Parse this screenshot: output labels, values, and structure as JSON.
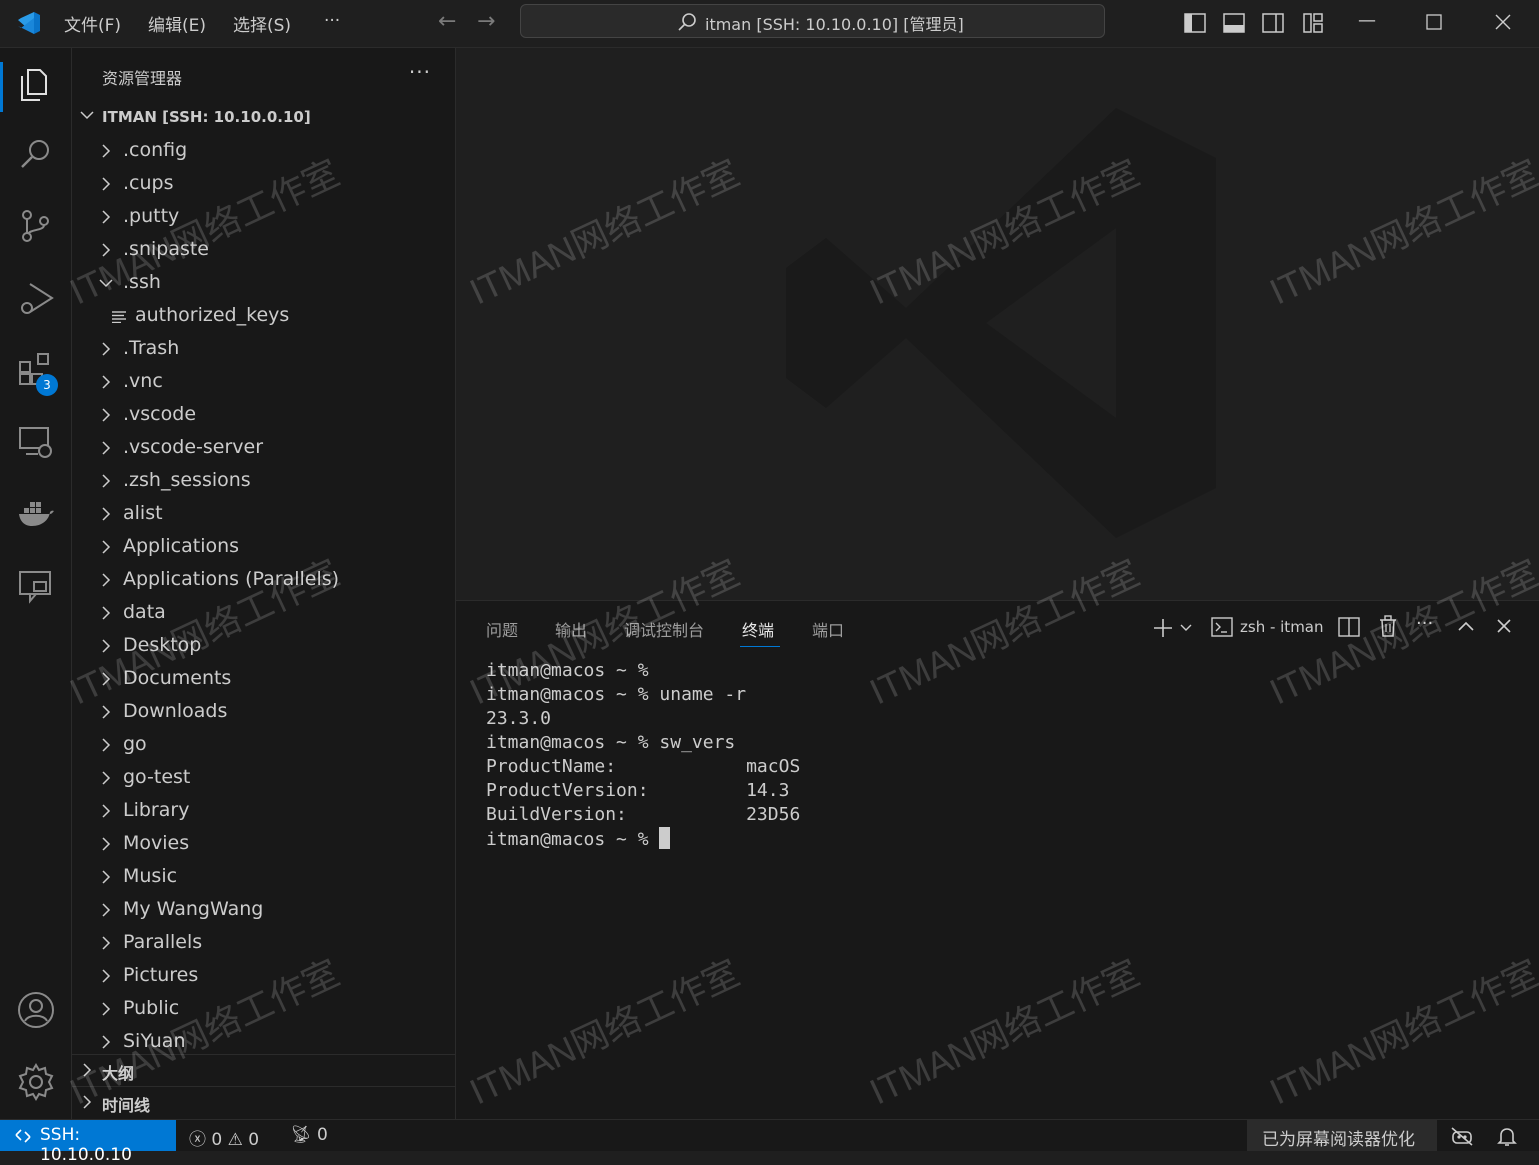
{
  "titlebar": {
    "menu": [
      "文件(F)",
      "编辑(E)",
      "选择(S)",
      "···"
    ],
    "command_center": "itman [SSH: 10.10.0.10] [管理员]"
  },
  "activity_bar": {
    "extensions_badge": "3"
  },
  "sidebar": {
    "title": "资源管理器",
    "more": "···",
    "root": "ITMAN [SSH: 10.10.0.10]",
    "items": [
      {
        "label": ".config",
        "type": "folder"
      },
      {
        "label": ".cups",
        "type": "folder"
      },
      {
        "label": ".putty",
        "type": "folder"
      },
      {
        "label": ".snipaste",
        "type": "folder"
      },
      {
        "label": ".ssh",
        "type": "folder-open"
      },
      {
        "label": "authorized_keys",
        "type": "file"
      },
      {
        "label": ".Trash",
        "type": "folder"
      },
      {
        "label": ".vnc",
        "type": "folder"
      },
      {
        "label": ".vscode",
        "type": "folder"
      },
      {
        "label": ".vscode-server",
        "type": "folder"
      },
      {
        "label": ".zsh_sessions",
        "type": "folder"
      },
      {
        "label": "alist",
        "type": "folder"
      },
      {
        "label": "Applications",
        "type": "folder"
      },
      {
        "label": "Applications (Parallels)",
        "type": "folder"
      },
      {
        "label": "data",
        "type": "folder"
      },
      {
        "label": "Desktop",
        "type": "folder"
      },
      {
        "label": "Documents",
        "type": "folder"
      },
      {
        "label": "Downloads",
        "type": "folder"
      },
      {
        "label": "go",
        "type": "folder"
      },
      {
        "label": "go-test",
        "type": "folder"
      },
      {
        "label": "Library",
        "type": "folder"
      },
      {
        "label": "Movies",
        "type": "folder"
      },
      {
        "label": "Music",
        "type": "folder"
      },
      {
        "label": "My WangWang",
        "type": "folder"
      },
      {
        "label": "Parallels",
        "type": "folder"
      },
      {
        "label": "Pictures",
        "type": "folder"
      },
      {
        "label": "Public",
        "type": "folder"
      },
      {
        "label": "SiYuan",
        "type": "folder"
      }
    ],
    "sections": [
      "大纲",
      "时间线"
    ]
  },
  "panel": {
    "tabs": [
      "问题",
      "输出",
      "调试控制台",
      "终端",
      "端口"
    ],
    "active_tab": "终端",
    "terminal_name": "zsh - itman",
    "terminal_lines": [
      "itman@macos ~ %",
      "itman@macos ~ % uname -r",
      "23.3.0",
      "itman@macos ~ % sw_vers",
      "ProductName:\t\tmacOS",
      "ProductVersion:\t\t14.3",
      "BuildVersion:\t\t23D56"
    ],
    "prompt": "itman@macos ~ % "
  },
  "statusbar": {
    "remote": "SSH: 10.10.0.10",
    "errors": "0",
    "warnings": "0",
    "ports": "0",
    "screen_reader": "已为屏幕阅读器优化"
  },
  "watermark": "ITMAN网络工作室",
  "colors": {
    "accent": "#0078d4",
    "bg": "#1f1f1f",
    "sidebar_bg": "#181818"
  }
}
